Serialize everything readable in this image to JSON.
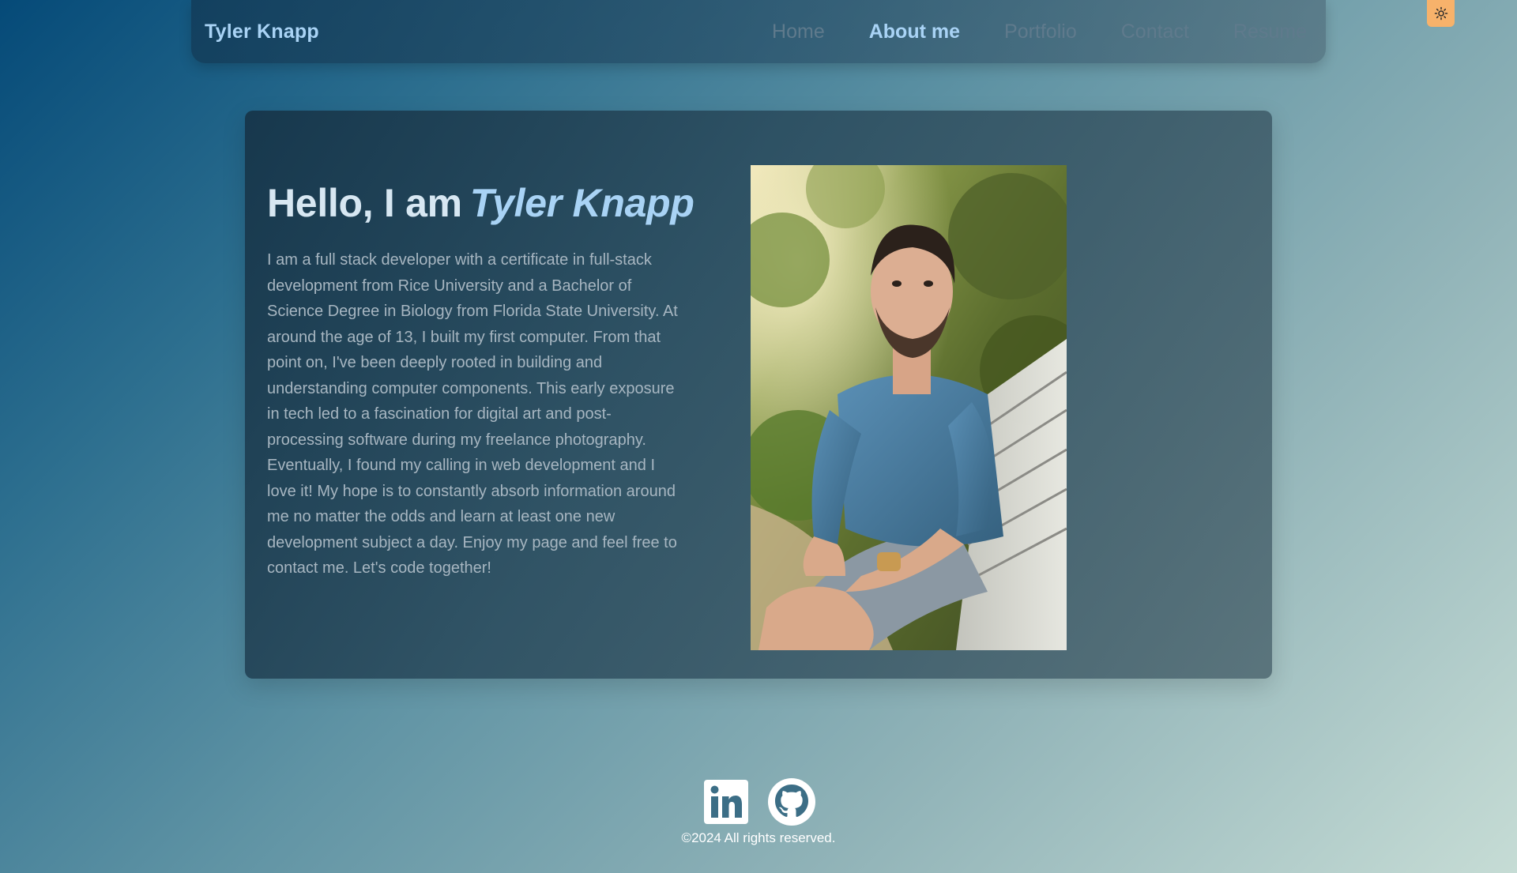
{
  "nav": {
    "brand": "Tyler Knapp",
    "links": [
      {
        "label": "Home",
        "active": false
      },
      {
        "label": "About me",
        "active": true
      },
      {
        "label": "Portfolio",
        "active": false
      },
      {
        "label": "Contact",
        "active": false
      },
      {
        "label": "Resume",
        "active": false
      }
    ],
    "theme_toggle_icon": "sun-icon"
  },
  "about": {
    "greeting": "Hello, I am",
    "name": "Tyler Knapp",
    "bio": "I am a full stack developer with a certificate in full-stack development from Rice University and a Bachelor of Science Degree in Biology from Florida State University. At around the age of 13, I built my first computer. From that point on, I've been deeply rooted in building and understanding computer components. This early exposure in tech led to a fascination for digital art and post-processing software during my freelance photography. Eventually, I found my calling in web development and I love it! My hope is to constantly absorb information around me no matter the odds and learn at least one new development subject a day. Enjoy my page and feel free to contact me. Let's code together!"
  },
  "footer": {
    "social": [
      "linkedin-icon",
      "github-icon"
    ],
    "copyright": "©2024 All rights reserved."
  },
  "colors": {
    "accent": "#a9d3f5",
    "toggle": "#f7b26b",
    "nav_inactive": "#5f7a8c",
    "bio_text": "#a7b6c1"
  }
}
